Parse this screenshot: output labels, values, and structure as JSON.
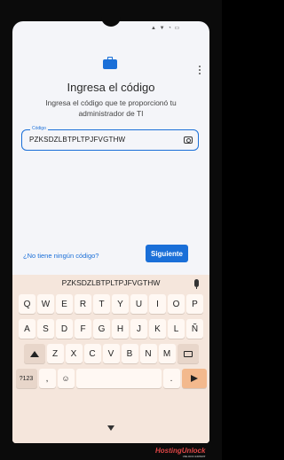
{
  "status_bar": {
    "icons": "▲ ▼ ◔ ▭"
  },
  "header": {
    "title": "Ingresa el código",
    "subtitle": "Ingresa el código que te proporcionó tu administrador de TI"
  },
  "code_field": {
    "label": "Código",
    "value": "PZKSDZLBTPLTPJFVGTHW"
  },
  "actions": {
    "no_code_link": "¿No tiene ningún código?",
    "next_label": "Siguiente"
  },
  "keyboard": {
    "suggestion": "PZKSDZLBTPLTPJFVGTHW",
    "row1": [
      "Q",
      "W",
      "E",
      "R",
      "T",
      "Y",
      "U",
      "I",
      "O",
      "P"
    ],
    "row2": [
      "A",
      "S",
      "D",
      "F",
      "G",
      "H",
      "J",
      "K",
      "L",
      "Ñ"
    ],
    "row3": [
      "Z",
      "X",
      "C",
      "V",
      "B",
      "N",
      "M"
    ],
    "symbols_label": "?123",
    "comma_label": ",",
    "period_label": ".",
    "emoji_icon": "☺",
    "accent_color": "#f3b98d"
  },
  "watermark": {
    "brand": "HostingUnlock",
    "tagline": "UNLOCK EXPERT"
  },
  "colors": {
    "primary": "#1a6fd8",
    "keyboard_bg": "#f5e6dc"
  }
}
